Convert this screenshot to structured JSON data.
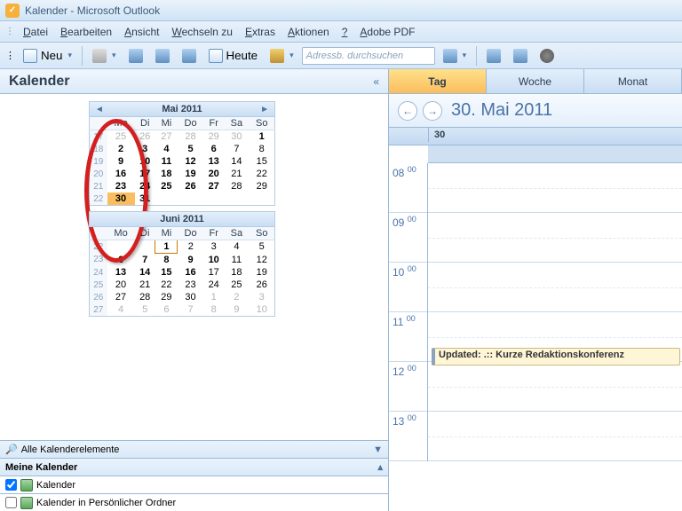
{
  "window": {
    "title": "Kalender - Microsoft Outlook"
  },
  "menu": {
    "items": [
      "Datei",
      "Bearbeiten",
      "Ansicht",
      "Wechseln zu",
      "Extras",
      "Aktionen",
      "?",
      "Adobe PDF"
    ]
  },
  "toolbar": {
    "new_label": "Neu",
    "today_label": "Heute",
    "search_placeholder": "Adressb. durchsuchen"
  },
  "sidebar": {
    "title": "Kalender",
    "collapse": "«",
    "months": [
      {
        "title": "Mai 2011",
        "show_nav": true,
        "dow": [
          "Mo",
          "Di",
          "Mi",
          "Do",
          "Fr",
          "Sa",
          "So"
        ],
        "weeks": [
          {
            "wk": "17",
            "days": [
              {
                "n": "25",
                "dim": true
              },
              {
                "n": "26",
                "dim": true
              },
              {
                "n": "27",
                "dim": true
              },
              {
                "n": "28",
                "dim": true
              },
              {
                "n": "29",
                "dim": true
              },
              {
                "n": "30",
                "dim": true
              },
              {
                "n": "1",
                "b": true
              }
            ]
          },
          {
            "wk": "18",
            "days": [
              {
                "n": "2",
                "b": true
              },
              {
                "n": "3",
                "b": true
              },
              {
                "n": "4",
                "b": true
              },
              {
                "n": "5",
                "b": true
              },
              {
                "n": "6",
                "b": true
              },
              {
                "n": "7"
              },
              {
                "n": "8"
              }
            ]
          },
          {
            "wk": "19",
            "days": [
              {
                "n": "9",
                "b": true
              },
              {
                "n": "10",
                "b": true
              },
              {
                "n": "11",
                "b": true
              },
              {
                "n": "12",
                "b": true
              },
              {
                "n": "13",
                "b": true
              },
              {
                "n": "14"
              },
              {
                "n": "15"
              }
            ]
          },
          {
            "wk": "20",
            "days": [
              {
                "n": "16",
                "b": true
              },
              {
                "n": "17",
                "b": true
              },
              {
                "n": "18",
                "b": true
              },
              {
                "n": "19",
                "b": true
              },
              {
                "n": "20",
                "b": true
              },
              {
                "n": "21"
              },
              {
                "n": "22"
              }
            ]
          },
          {
            "wk": "21",
            "days": [
              {
                "n": "23",
                "b": true
              },
              {
                "n": "24",
                "b": true
              },
              {
                "n": "25",
                "b": true
              },
              {
                "n": "26",
                "b": true
              },
              {
                "n": "27",
                "b": true
              },
              {
                "n": "28"
              },
              {
                "n": "29"
              }
            ]
          },
          {
            "wk": "22",
            "days": [
              {
                "n": "30",
                "b": true,
                "sel": true
              },
              {
                "n": "31",
                "b": true
              },
              {
                "n": ""
              },
              {
                "n": ""
              },
              {
                "n": ""
              },
              {
                "n": ""
              },
              {
                "n": ""
              }
            ]
          }
        ]
      },
      {
        "title": "Juni 2011",
        "show_nav": false,
        "dow": [
          "Mo",
          "Di",
          "Mi",
          "Do",
          "Fr",
          "Sa",
          "So"
        ],
        "weeks": [
          {
            "wk": "22",
            "days": [
              {
                "n": ""
              },
              {
                "n": ""
              },
              {
                "n": "1",
                "b": true,
                "today": true
              },
              {
                "n": "2"
              },
              {
                "n": "3"
              },
              {
                "n": "4"
              },
              {
                "n": "5"
              }
            ]
          },
          {
            "wk": "23",
            "days": [
              {
                "n": "6",
                "b": true
              },
              {
                "n": "7",
                "b": true
              },
              {
                "n": "8",
                "b": true
              },
              {
                "n": "9",
                "b": true
              },
              {
                "n": "10",
                "b": true
              },
              {
                "n": "11"
              },
              {
                "n": "12"
              }
            ]
          },
          {
            "wk": "24",
            "days": [
              {
                "n": "13",
                "b": true
              },
              {
                "n": "14",
                "b": true
              },
              {
                "n": "15",
                "b": true
              },
              {
                "n": "16",
                "b": true
              },
              {
                "n": "17"
              },
              {
                "n": "18"
              },
              {
                "n": "19"
              }
            ]
          },
          {
            "wk": "25",
            "days": [
              {
                "n": "20"
              },
              {
                "n": "21"
              },
              {
                "n": "22"
              },
              {
                "n": "23"
              },
              {
                "n": "24"
              },
              {
                "n": "25"
              },
              {
                "n": "26"
              }
            ]
          },
          {
            "wk": "26",
            "days": [
              {
                "n": "27"
              },
              {
                "n": "28"
              },
              {
                "n": "29"
              },
              {
                "n": "30"
              },
              {
                "n": "1",
                "dim": true
              },
              {
                "n": "2",
                "dim": true
              },
              {
                "n": "3",
                "dim": true
              }
            ]
          },
          {
            "wk": "27",
            "days": [
              {
                "n": "4",
                "dim": true
              },
              {
                "n": "5",
                "dim": true
              },
              {
                "n": "6",
                "dim": true
              },
              {
                "n": "7",
                "dim": true
              },
              {
                "n": "8",
                "dim": true
              },
              {
                "n": "9",
                "dim": true
              },
              {
                "n": "10",
                "dim": true
              }
            ]
          }
        ]
      }
    ],
    "all_items": "Alle Kalenderelemente",
    "my_cal_heading": "Meine Kalender",
    "cal1": "Kalender",
    "cal2": "Kalender in Persönlicher Ordner"
  },
  "dayview": {
    "tabs": {
      "day": "Tag",
      "week": "Woche",
      "month": "Monat"
    },
    "date_title": "30. Mai 2011",
    "day_number": "30",
    "hours": [
      "08",
      "09",
      "10",
      "11",
      "12",
      "13"
    ],
    "minute_suffix": "00",
    "appointment": "Updated: .:: Kurze Redaktionskonferenz"
  }
}
